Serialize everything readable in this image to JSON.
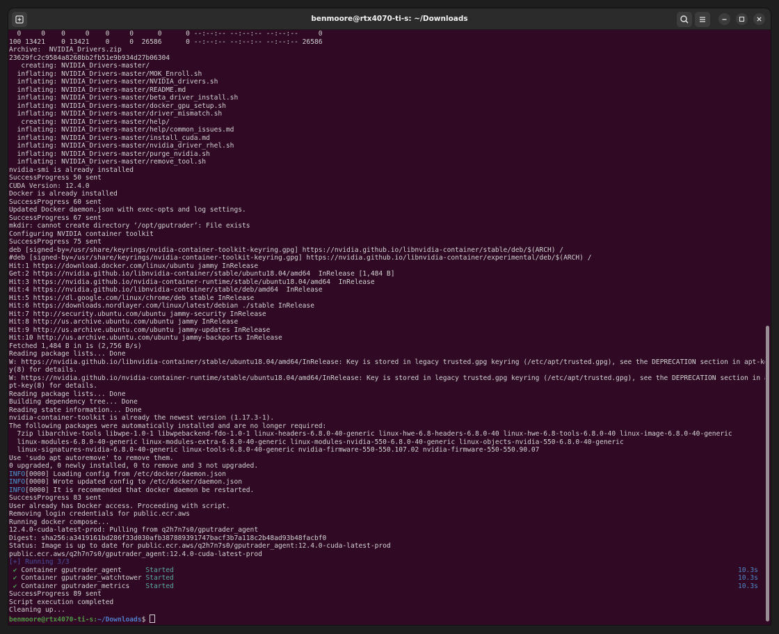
{
  "window": {
    "title": "benmoore@rtx4070-ti-s: ~/Downloads"
  },
  "terminal": {
    "lines": [
      "  0     0    0     0    0     0      0      0 --:--:-- --:--:-- --:--:--     0",
      "100 13421    0 13421    0     0  26586      0 --:--:-- --:--:-- --:--:-- 26586",
      "Archive:  NVIDIA_Drivers.zip",
      "23629fc2c9584a8268bb2fb51e9b934d27b06304",
      "   creating: NVIDIA_Drivers-master/",
      "  inflating: NVIDIA_Drivers-master/MOK_Enroll.sh",
      "  inflating: NVIDIA_Drivers-master/NVIDIA_drivers.sh",
      "  inflating: NVIDIA_Drivers-master/README.md",
      "  inflating: NVIDIA_Drivers-master/beta_driver_install.sh",
      "  inflating: NVIDIA_Drivers-master/docker_gpu_setup.sh",
      "  inflating: NVIDIA_Drivers-master/driver_mismatch.sh",
      "   creating: NVIDIA_Drivers-master/help/",
      "  inflating: NVIDIA_Drivers-master/help/common_issues.md",
      "  inflating: NVIDIA_Drivers-master/install_cuda.md",
      "  inflating: NVIDIA_Drivers-master/nvidia_driver_rhel.sh",
      "  inflating: NVIDIA_Drivers-master/purge_nvidia.sh",
      "  inflating: NVIDIA_Drivers-master/remove_tool.sh",
      "nvidia-smi is already installed",
      "SuccessProgress 50 sent",
      "CUDA Version: 12.4.0",
      "Docker is already installed",
      "SuccessProgress 60 sent",
      "Updated Docker daemon.json with exec-opts and log settings.",
      "SuccessProgress 67 sent",
      "mkdir: cannot create directory ‘/opt/gputrader’: File exists",
      "Configuring NVIDIA container toolkit",
      "SuccessProgress 75 sent",
      "deb [signed-by=/usr/share/keyrings/nvidia-container-toolkit-keyring.gpg] https://nvidia.github.io/libnvidia-container/stable/deb/$(ARCH) /",
      "#deb [signed-by=/usr/share/keyrings/nvidia-container-toolkit-keyring.gpg] https://nvidia.github.io/libnvidia-container/experimental/deb/$(ARCH) /",
      "Hit:1 https://download.docker.com/linux/ubuntu jammy InRelease",
      "Get:2 https://nvidia.github.io/libnvidia-container/stable/ubuntu18.04/amd64  InRelease [1,484 B]",
      "Hit:3 https://nvidia.github.io/nvidia-container-runtime/stable/ubuntu18.04/amd64  InRelease",
      "Hit:4 https://nvidia.github.io/libnvidia-container/stable/deb/amd64  InRelease",
      "Hit:5 https://dl.google.com/linux/chrome/deb stable InRelease",
      "Hit:6 https://downloads.nordlayer.com/linux/latest/debian ./stable InRelease",
      "Hit:7 http://security.ubuntu.com/ubuntu jammy-security InRelease",
      "Hit:8 http://us.archive.ubuntu.com/ubuntu jammy InRelease",
      "Hit:9 http://us.archive.ubuntu.com/ubuntu jammy-updates InRelease",
      "Hit:10 http://us.archive.ubuntu.com/ubuntu jammy-backports InRelease",
      "Fetched 1,484 B in 1s (2,756 B/s)",
      "Reading package lists... Done",
      "W: https://nvidia.github.io/libnvidia-container/stable/ubuntu18.04/amd64/InRelease: Key is stored in legacy trusted.gpg keyring (/etc/apt/trusted.gpg), see the DEPRECATION section in apt-ke",
      "y(8) for details.",
      "W: https://nvidia.github.io/nvidia-container-runtime/stable/ubuntu18.04/amd64/InRelease: Key is stored in legacy trusted.gpg keyring (/etc/apt/trusted.gpg), see the DEPRECATION section in a",
      "pt-key(8) for details.",
      "Reading package lists... Done",
      "Building dependency tree... Done",
      "Reading state information... Done",
      "nvidia-container-toolkit is already the newest version (1.17.3-1).",
      "The following packages were automatically installed and are no longer required:",
      "  7zip libarchive-tools libwpe-1.0-1 libwpebackend-fdo-1.0-1 linux-headers-6.8.0-40-generic linux-hwe-6.8-headers-6.8.0-40 linux-hwe-6.8-tools-6.8.0-40 linux-image-6.8.0-40-generic",
      "  linux-modules-6.8.0-40-generic linux-modules-extra-6.8.0-40-generic linux-modules-nvidia-550-6.8.0-40-generic linux-objects-nvidia-550-6.8.0-40-generic",
      "  linux-signatures-nvidia-6.8.0-40-generic linux-tools-6.8.0-40-generic nvidia-firmware-550-550.107.02 nvidia-firmware-550-550.90.07",
      "Use 'sudo apt autoremove' to remove them.",
      "0 upgraded, 0 newly installed, 0 to remove and 3 not upgraded."
    ],
    "info_tag": "INFO",
    "info_lines": [
      "[0000] Loading config from /etc/docker/daemon.json",
      "[0000] Wrote updated config to /etc/docker/daemon.json",
      "[0000] It is recommended that docker daemon be restarted."
    ],
    "lines_after_info": [
      "SuccessProgress 83 sent",
      "User already has Docker access. Proceeding with script.",
      "Removing login credentials for public.ecr.aws",
      "Running docker compose...",
      "12.4.0-cuda-latest-prod: Pulling from q2h7n7s0/gputrader_agent",
      "Digest: sha256:a3419161bd286f33d030afb387889391747bacf3b7a118c2b48ad93b48facbf0",
      "Status: Image is up to date for public.ecr.aws/q2h7n7s0/gputrader_agent:12.4.0-cuda-latest-prod",
      "public.ecr.aws/q2h7n7s0/gputrader_agent:12.4.0-cuda-latest-prod"
    ],
    "running_line": "[+] Running 3/3",
    "check_glyph": "✔",
    "containers": [
      {
        "label": "Container gputrader_agent      ",
        "status": "Started",
        "elapsed": "10.3s"
      },
      {
        "label": "Container gputrader_watchtower ",
        "status": "Started",
        "elapsed": "10.3s"
      },
      {
        "label": "Container gputrader_metrics    ",
        "status": "Started",
        "elapsed": "10.3s"
      }
    ],
    "tail_lines": [
      "SuccessProgress 89 sent",
      "Script execution completed",
      "Cleaning up..."
    ],
    "prompt": {
      "user_host": "benmoore@rtx4070-ti-s",
      "separator": ":",
      "path": "~/Downloads",
      "symbol": "$ "
    }
  }
}
